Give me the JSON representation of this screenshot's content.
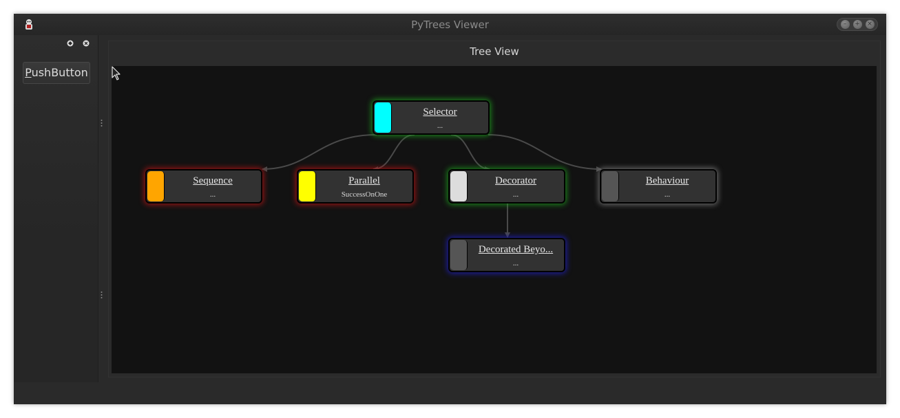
{
  "window": {
    "title": "PyTrees Viewer"
  },
  "dock": {
    "button_mnemonic": "P",
    "button_rest": "ushButton"
  },
  "panel": {
    "title": "Tree View"
  },
  "colors": {
    "selector": "#00ffff",
    "sequence": "#ffa500",
    "parallel": "#ffff00",
    "decorator": "#dddddd",
    "behaviour": "#555555",
    "decorated": "#555555"
  },
  "nodes": {
    "selector": {
      "name": "Selector",
      "detail": "..."
    },
    "sequence": {
      "name": "Sequence",
      "detail": "..."
    },
    "parallel": {
      "name": "Parallel",
      "detail": "SuccessOnOne"
    },
    "decorator": {
      "name": "Decorator",
      "detail": "..."
    },
    "behaviour": {
      "name": "Behaviour",
      "detail": "..."
    },
    "decorated": {
      "name": "Decorated Beyo...",
      "detail": "..."
    }
  }
}
